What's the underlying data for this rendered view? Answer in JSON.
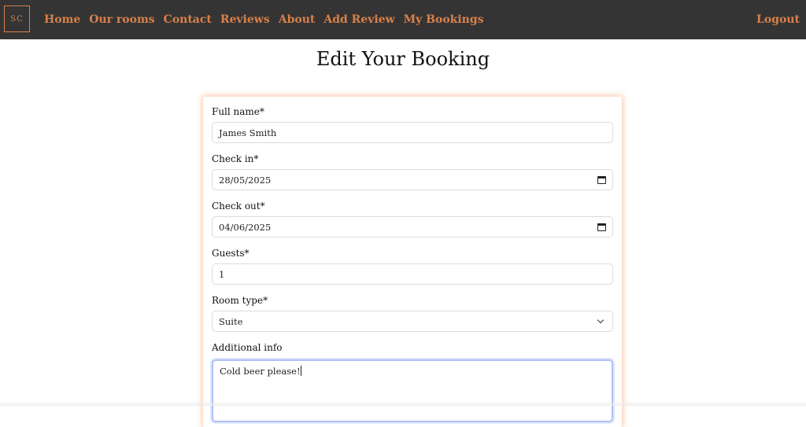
{
  "nav": {
    "logo": "SC",
    "links": [
      "Home",
      "Our rooms",
      "Contact",
      "Reviews",
      "About",
      "Add Review",
      "My Bookings"
    ],
    "logout": "Logout"
  },
  "page": {
    "title": "Edit Your Booking"
  },
  "form": {
    "full_name_label": "Full name*",
    "full_name_value": "James Smith",
    "check_in_label": "Check in*",
    "check_in_value": "28/05/2025",
    "check_out_label": "Check out*",
    "check_out_value": "04/06/2025",
    "guests_label": "Guests*",
    "guests_value": "1",
    "room_type_label": "Room type*",
    "room_type_value": "Suite",
    "additional_info_label": "Additional info",
    "additional_info_value": "Cold beer please!"
  },
  "colors": {
    "navbar_bg": "#343434",
    "accent": "#d9804a",
    "focus": "#aebff5"
  },
  "icons": {
    "date_picker": "calendar-icon",
    "select": "chevron-down-icon"
  }
}
